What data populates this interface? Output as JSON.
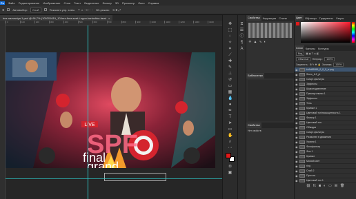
{
  "menu": [
    "Файл",
    "Редактирование",
    "Изображение",
    "Слои",
    "Текст",
    "Выделение",
    "Фильтр",
    "3D",
    "Просмотр",
    "Окно",
    "Справка"
  ],
  "options": {
    "auto_select": "Автовыбор:",
    "layer_select": "Слой",
    "transform": "Показать упр. элем.",
    "mode3d": "3D-режим:"
  },
  "document": {
    "tab": "bez-nazvaniya-1.psd @ 66,7% (100201619_10-bez-fona-svet-i-ogon-kartochka-bezdokumentnyj-faylov-10, RGB/8#)",
    "close": "×"
  },
  "ruler_ticks": [
    "0",
    "100",
    "200",
    "300",
    "400",
    "500",
    "600",
    "700",
    "800",
    "900",
    "1000",
    "1100",
    "1200",
    "1300",
    "1400"
  ],
  "canvas": {
    "live": "LIVE",
    "spf": "SPF",
    "grand": "grand",
    "final": "final"
  },
  "mid": {
    "tabs": [
      "Свойства",
      "Коррекция",
      "Стили"
    ],
    "section": "Библиотеки",
    "props": "Свойства",
    "props_sub": "Нет свойств",
    "icons": [
      "adjust-icon",
      "levels-icon",
      "curves-icon"
    ]
  },
  "right": {
    "top_tabs": [
      "Цвет",
      "Образцы",
      "Градиенты",
      "Узоры"
    ],
    "layer_tabs": [
      "Слои",
      "Каналы",
      "Контуры"
    ],
    "kind": "Вид",
    "blend": "Обычные",
    "opacity_label": "Непрозр.:",
    "opacity": "100%",
    "lock_label": "Закрепить:",
    "fill_label": "Заливка:",
    "fill": "100%",
    "layers": [
      "kb9d65056_0_0_0_a.png",
      "Slovo_6.2_pl",
      "Смарт-фильтры",
      "Эффекты",
      "Шумоподавление",
      "Прямоугольник 1",
      "Эффекты",
      "Тень",
      "Кривые 1",
      "Цветовой тон/насыщенность 1",
      "Фильтр 1",
      "Цветовой тон",
      "Обводка",
      "Смарт-фильтры",
      "Размытие в движении",
      "Уровни 1",
      "Фотофильтр",
      "Фон 1",
      "Кривые",
      "Мягкий свет",
      "ring",
      "Слой 2",
      "Пустота",
      "Цветовой тон 1",
      "Смарт-фильтры",
      "Эффекты",
      "fire_png.png",
      "Шумоподавление",
      "Размытие по Гауссу"
    ],
    "selected": 0,
    "bottom_icons": [
      "link-icon",
      "fx-icon",
      "mask-icon",
      "adjust-icon",
      "folder-icon",
      "new-layer-icon",
      "trash-icon"
    ]
  },
  "colors": {
    "accent": "#3e5570",
    "guide": "#2ec5c5",
    "fg": "#e01a1a",
    "bg": "#ffffff"
  }
}
